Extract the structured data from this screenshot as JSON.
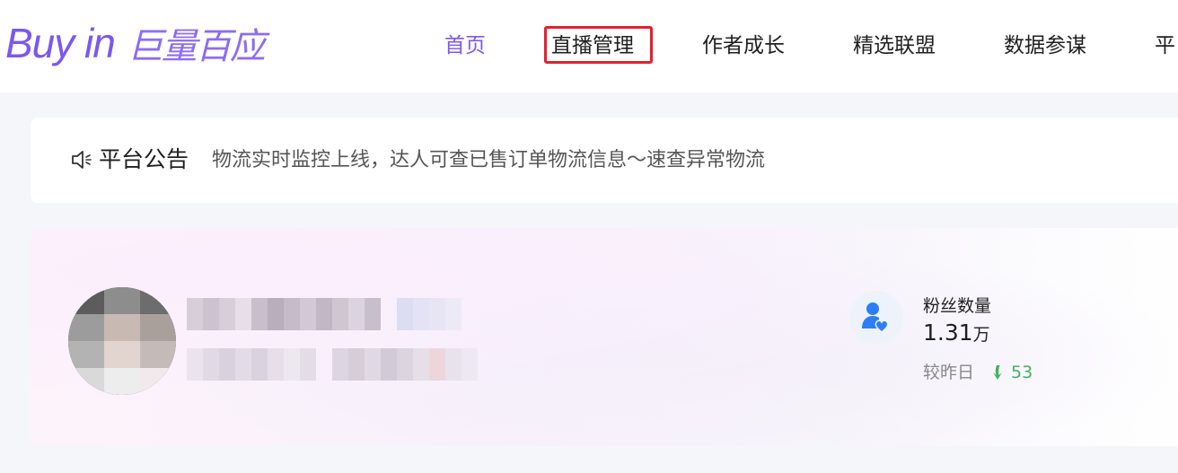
{
  "header": {
    "logo_latin": "Buy in",
    "logo_cn": "巨量百应",
    "brand_color": "#7b57f1",
    "nav": [
      {
        "label": "首页",
        "active": true
      },
      {
        "label": "直播管理",
        "active": false,
        "highlighted": true
      },
      {
        "label": "作者成长",
        "active": false
      },
      {
        "label": "精选联盟",
        "active": false
      },
      {
        "label": "数据参谋",
        "active": false
      },
      {
        "label": "平",
        "active": false
      }
    ]
  },
  "notice": {
    "icon": "speaker-icon",
    "title": "平台公告",
    "text": "物流实时监控上线，达人可查已售订单物流信息～速查异常物流"
  },
  "profile": {
    "avatar": "avatar",
    "fans": {
      "icon": "user-heart-icon",
      "label": "粉丝数量",
      "value": "1.31",
      "unit": "万",
      "compare_label": "较昨日",
      "delta": "53",
      "delta_icon": "arrow-down-icon",
      "delta_color": "#3fb35a"
    }
  }
}
